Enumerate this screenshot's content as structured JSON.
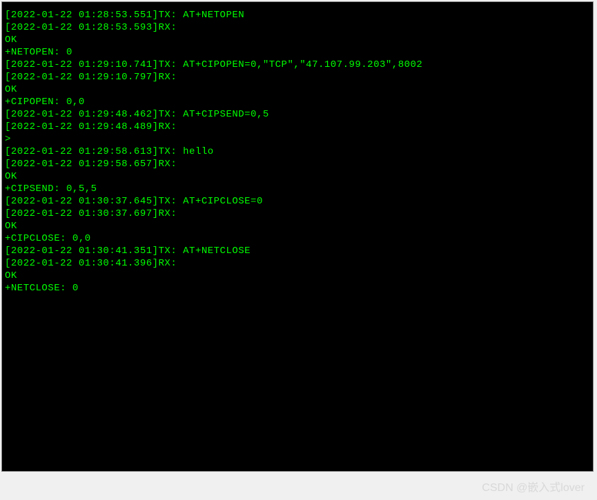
{
  "terminal": {
    "lines": [
      "[2022-01-22 01:28:53.551]TX: AT+NETOPEN",
      "",
      "[2022-01-22 01:28:53.593]RX: ",
      "OK",
      "",
      "+NETOPEN: 0",
      "",
      "[2022-01-22 01:29:10.741]TX: AT+CIPOPEN=0,\"TCP\",\"47.107.99.203\",8002",
      "",
      "[2022-01-22 01:29:10.797]RX: ",
      "OK",
      "",
      "+CIPOPEN: 0,0",
      "",
      "[2022-01-22 01:29:48.462]TX: AT+CIPSEND=0,5",
      "",
      "[2022-01-22 01:29:48.489]RX: ",
      ">",
      "[2022-01-22 01:29:58.613]TX: hello",
      "",
      "[2022-01-22 01:29:58.657]RX: ",
      "OK",
      "",
      "+CIPSEND: 0,5,5",
      "",
      "[2022-01-22 01:30:37.645]TX: AT+CIPCLOSE=0",
      "",
      "[2022-01-22 01:30:37.697]RX: ",
      "OK",
      "",
      "+CIPCLOSE: 0,0",
      "",
      "[2022-01-22 01:30:41.351]TX: AT+NETCLOSE",
      "",
      "[2022-01-22 01:30:41.396]RX: ",
      "OK",
      "",
      "+NETCLOSE: 0"
    ]
  },
  "watermark": "CSDN @嵌入式lover"
}
